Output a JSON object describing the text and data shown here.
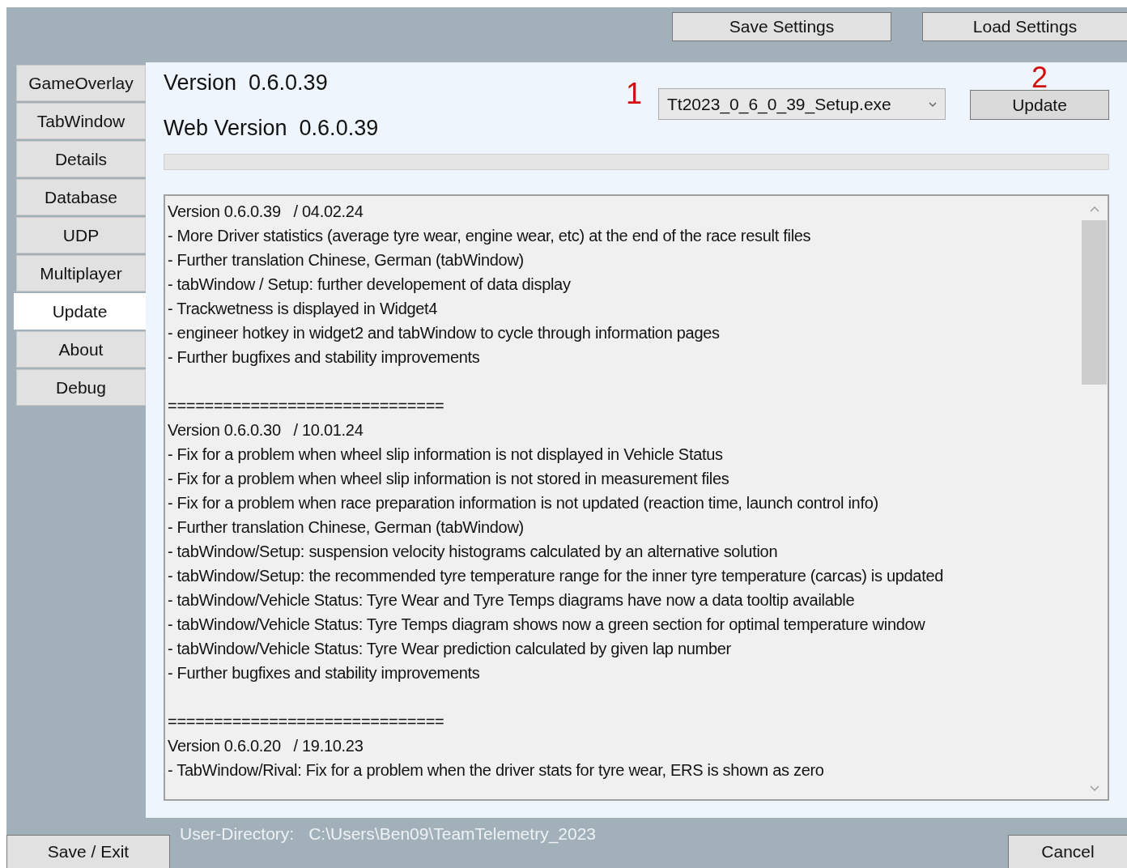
{
  "toolbar": {
    "buttons": [
      "Save Settings",
      "Load Settings"
    ]
  },
  "sidebar": {
    "items": [
      {
        "label": "GameOverlay",
        "selected": false
      },
      {
        "label": "TabWindow",
        "selected": false
      },
      {
        "label": "Details",
        "selected": false
      },
      {
        "label": "Database",
        "selected": false
      },
      {
        "label": "UDP",
        "selected": false
      },
      {
        "label": "Multiplayer",
        "selected": false
      },
      {
        "label": "Update",
        "selected": true
      },
      {
        "label": "About",
        "selected": false
      },
      {
        "label": "Debug",
        "selected": false
      }
    ]
  },
  "update": {
    "version_label": "Version",
    "version": "0.6.0.39",
    "web_version_label": "Web Version",
    "web_version": "0.6.0.39",
    "step_markers": [
      "1",
      "2"
    ],
    "installer": "Tt2023_0_6_0_39_Setup.exe",
    "update_button": "Update",
    "progress": {
      "level": 0
    }
  },
  "changelog": [
    {
      "title": "Version 0.6.0.39   / 04.02.24",
      "items": [
        "- More Driver statistics (average tyre wear, engine wear, etc) at the end of the race result files",
        "- Further translation Chinese, German (tabWindow)",
        "- tabWindow / Setup: further developement of data display",
        "- Trackwetness is displayed in Widget4",
        "- engineer hotkey in widget2 and tabWindow to cycle through information pages",
        "- Further bugfixes and stability improvements"
      ]
    },
    {
      "separator": "==============================",
      "title": "Version 0.6.0.30   / 10.01.24",
      "items": [
        "- Fix for a problem when wheel slip information is not displayed in Vehicle Status",
        "- Fix for a problem when wheel slip information is not stored in measurement files",
        "- Fix for a problem when race preparation information is not updated (reaction time, launch control info)",
        "- Further translation Chinese, German (tabWindow)",
        "- tabWindow/Setup: suspension velocity histograms calculated by an alternative solution",
        "- tabWindow/Setup: the recommended tyre temperature range for the inner tyre temperature (carcas) is updated",
        "- tabWindow/Vehicle Status: Tyre Wear and Tyre Temps diagrams have now a data tooltip available",
        "- tabWindow/Vehicle Status: Tyre Temps diagram shows now a green section for optimal temperature window",
        "- tabWindow/Vehicle Status: Tyre Wear prediction calculated by given lap number",
        "- Further bugfixes and stability improvements"
      ]
    },
    {
      "separator": "==============================",
      "title": "Version 0.6.0.20   / 19.10.23",
      "items": [
        "- TabWindow/Rival: Fix for a problem when the driver stats for tyre wear, ERS is shown as zero"
      ]
    }
  ],
  "footer": {
    "save_button": "Save / Exit",
    "directory_label": "User-Directory:",
    "directory": "C:\\Users\\Ben09\\TeamTelemetry_2023",
    "cancel_button": "Cancel"
  }
}
